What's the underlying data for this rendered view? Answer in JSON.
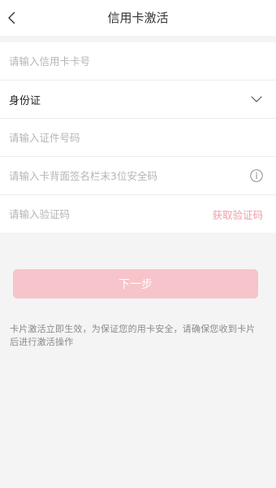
{
  "header": {
    "title": "信用卡激活",
    "back_icon": "chevron-left-icon"
  },
  "form": {
    "card_number": {
      "placeholder": "请输入信用卡卡号",
      "value": ""
    },
    "id_type": {
      "selected": "身份证",
      "icon": "chevron-down-icon"
    },
    "id_number": {
      "placeholder": "请输入证件号码",
      "value": ""
    },
    "security_code": {
      "placeholder": "请输入卡背面签名栏末3位安全码",
      "value": "",
      "icon": "info-icon"
    },
    "verification_code": {
      "placeholder": "请输入验证码",
      "value": "",
      "get_code_label": "获取验证码"
    }
  },
  "actions": {
    "next_label": "下一步",
    "next_enabled": false
  },
  "notice": {
    "text": "卡片激活立即生效，为保证您的用卡安全，请确保您收到卡片后进行激活操作"
  },
  "colors": {
    "page_background": "#f4f4f4",
    "surface": "#ffffff",
    "title_text": "#333333",
    "placeholder_text": "#b5b5b5",
    "accent": "#f29ca6",
    "button_disabled": "#f6c4ca",
    "notice_text": "#8a8a8a"
  }
}
